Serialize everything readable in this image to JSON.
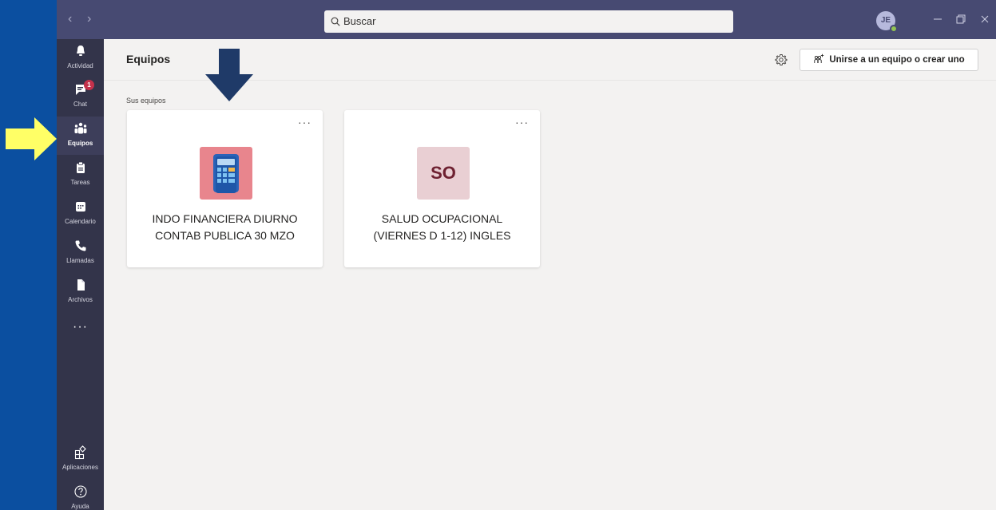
{
  "titlebar": {
    "search_placeholder": "Buscar",
    "avatar_initials": "JE"
  },
  "rail": {
    "items": [
      {
        "label": "Actividad",
        "icon": "bell-icon"
      },
      {
        "label": "Chat",
        "icon": "chat-icon",
        "badge": "1"
      },
      {
        "label": "Equipos",
        "icon": "teams-icon",
        "active": true
      },
      {
        "label": "Tareas",
        "icon": "tasks-icon"
      },
      {
        "label": "Calendario",
        "icon": "calendar-icon"
      },
      {
        "label": "Llamadas",
        "icon": "phone-icon"
      },
      {
        "label": "Archivos",
        "icon": "file-icon"
      }
    ],
    "more": "···",
    "bottom_items": [
      {
        "label": "Aplicaciones",
        "icon": "apps-icon"
      },
      {
        "label": "Ayuda",
        "icon": "help-icon"
      }
    ]
  },
  "main": {
    "title": "Equipos",
    "join_button_label": "Unirse a un equipo o crear uno",
    "section_label": "Sus equipos",
    "teams": [
      {
        "name_line1": "INDO FINANCIERA DIURNO",
        "name_line2": "CONTAB PUBLICA 30 MZO",
        "avatar_icon": "calculator-icon",
        "avatar_color": "#e8858d"
      },
      {
        "name_line1": "SALUD OCUPACIONAL",
        "name_line2": "(VIERNES D 1-12) INGLES",
        "avatar_text": "SO",
        "avatar_color": "#e9cfd3",
        "avatar_text_color": "#6e2131"
      }
    ],
    "card_more": "···"
  },
  "colors": {
    "titlebar": "#474a72",
    "rail": "#33344a",
    "background": "#f3f2f1",
    "outer": "#0b4fa0",
    "annotation_yellow": "#ffff66",
    "annotation_navy": "#1f3a68"
  }
}
